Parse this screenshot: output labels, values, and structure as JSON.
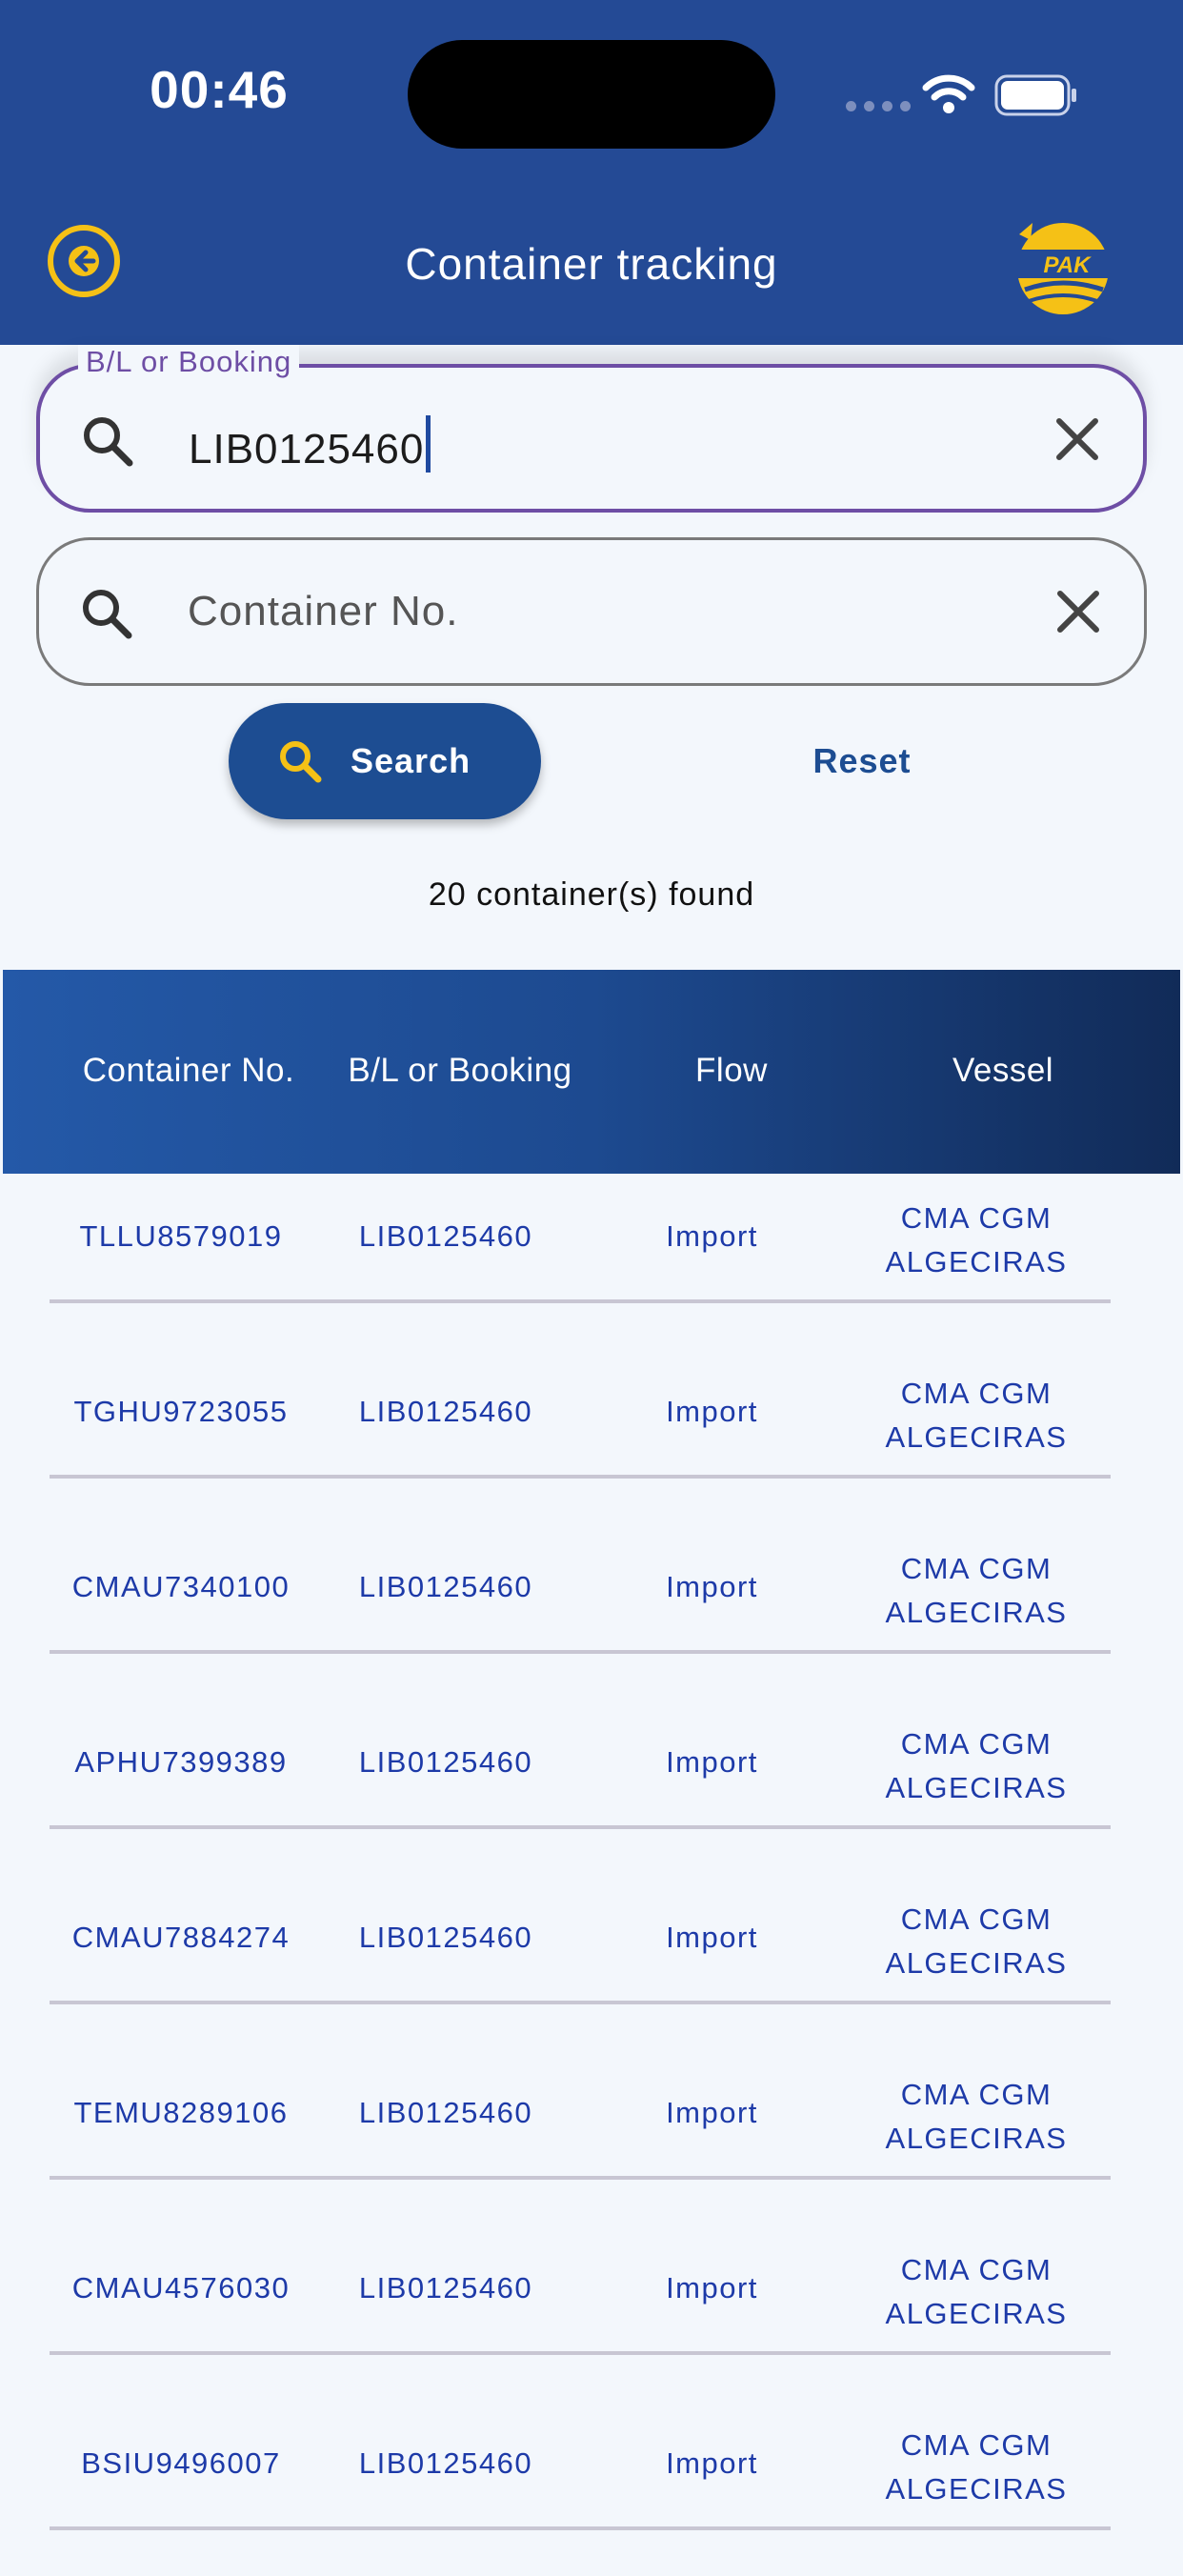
{
  "status_bar": {
    "time": "00:46"
  },
  "header": {
    "title": "Container tracking",
    "logo_text": "PAK"
  },
  "search": {
    "booking": {
      "label": "B/L or Booking",
      "value": "LIB0125460"
    },
    "container": {
      "placeholder": "Container No.",
      "value": ""
    },
    "search_button": "Search",
    "reset_button": "Reset",
    "result_count": "20 container(s) found"
  },
  "table": {
    "headers": [
      "Container No.",
      "B/L or Booking",
      "Flow",
      "Vessel"
    ],
    "rows": [
      [
        "TLLU8579019",
        "LIB0125460",
        "Import",
        "CMA CGM ALGECIRAS"
      ],
      [
        "TGHU9723055",
        "LIB0125460",
        "Import",
        "CMA CGM ALGECIRAS"
      ],
      [
        "CMAU7340100",
        "LIB0125460",
        "Import",
        "CMA CGM ALGECIRAS"
      ],
      [
        "APHU7399389",
        "LIB0125460",
        "Import",
        "CMA CGM ALGECIRAS"
      ],
      [
        "CMAU7884274",
        "LIB0125460",
        "Import",
        "CMA CGM ALGECIRAS"
      ],
      [
        "TEMU8289106",
        "LIB0125460",
        "Import",
        "CMA CGM ALGECIRAS"
      ],
      [
        "CMAU4576030",
        "LIB0125460",
        "Import",
        "CMA CGM ALGECIRAS"
      ],
      [
        "BSIU9496007",
        "LIB0125460",
        "Import",
        "CMA CGM ALGECIRAS"
      ]
    ]
  },
  "colors": {
    "header_bg": "#244a95",
    "accent_yellow": "#f5c116",
    "focus_purple": "#6e4ea5",
    "button_blue": "#1d4d92",
    "cell_text": "#1d3aa8"
  },
  "icons": [
    "back-arrow-icon",
    "pak-logo",
    "search-icon",
    "close-icon",
    "wifi-icon",
    "battery-icon"
  ]
}
